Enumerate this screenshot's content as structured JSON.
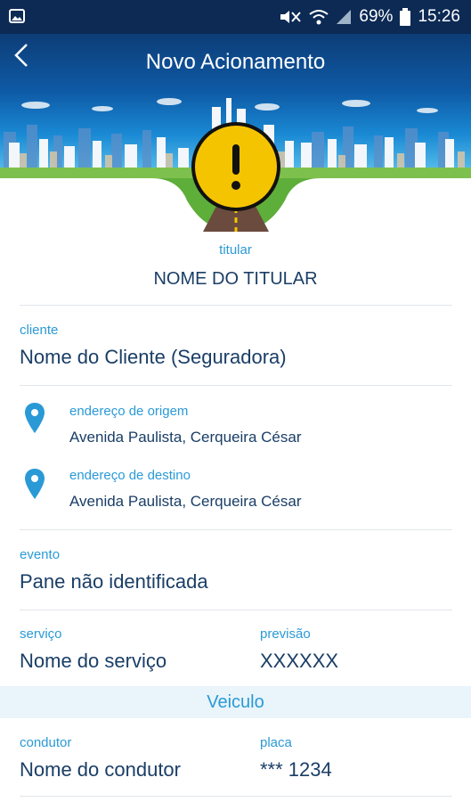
{
  "status_bar": {
    "battery": "69%",
    "time": "15:26"
  },
  "header": {
    "title": "Novo Acionamento"
  },
  "holder": {
    "label": "titular",
    "value": "NOME DO TITULAR"
  },
  "client": {
    "label": "cliente",
    "value": "Nome do Cliente (Seguradora)"
  },
  "origin": {
    "label": "endereço de origem",
    "value": "Avenida Paulista, Cerqueira César"
  },
  "destination": {
    "label": "endereço de destino",
    "value": "Avenida Paulista, Cerqueira César"
  },
  "event": {
    "label": "evento",
    "value": "Pane não identificada"
  },
  "service": {
    "label": "serviço",
    "value": "Nome do serviço"
  },
  "forecast": {
    "label": "previsão",
    "value": "XXXXXX"
  },
  "vehicle_section": {
    "title": "Veiculo"
  },
  "driver": {
    "label": "condutor",
    "value": "Nome do condutor"
  },
  "plate": {
    "label": "placa",
    "value": "*** 1234"
  },
  "colors": {
    "status_bar": "#0c2a54",
    "accent": "#2a9ad6",
    "text": "#1a3e66",
    "warning": "#f5c400"
  }
}
